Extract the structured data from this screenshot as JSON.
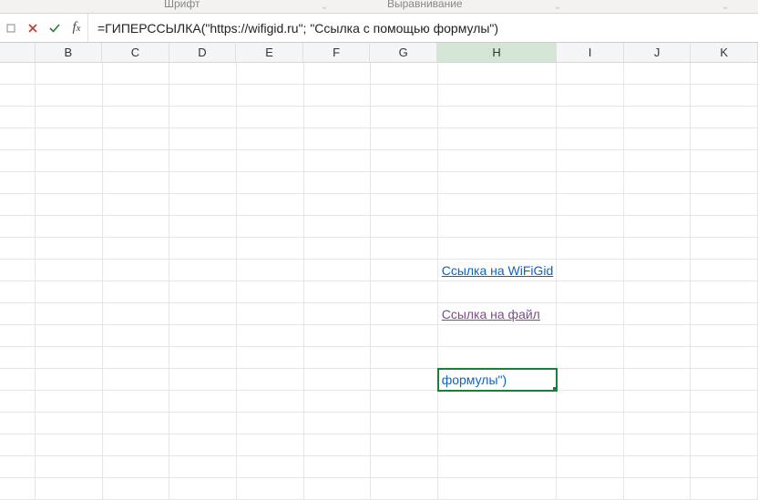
{
  "ribbon": {
    "group_font": "Шрифт",
    "group_align": "Выравнивание",
    "group_styles": ""
  },
  "formulaBar": {
    "formula": "=ГИПЕРССЫЛКА(\"https://wifigid.ru\"; \"Ссылка с помощью формулы\")"
  },
  "columns": [
    "",
    "B",
    "C",
    "D",
    "E",
    "F",
    "G",
    "H",
    "I",
    "J",
    "K"
  ],
  "selectedColumn": "H",
  "hyperlink1": "Ссылка на WiFiGid",
  "hyperlink2": "Ссылка на файл",
  "activeCellText": "формулы\")"
}
